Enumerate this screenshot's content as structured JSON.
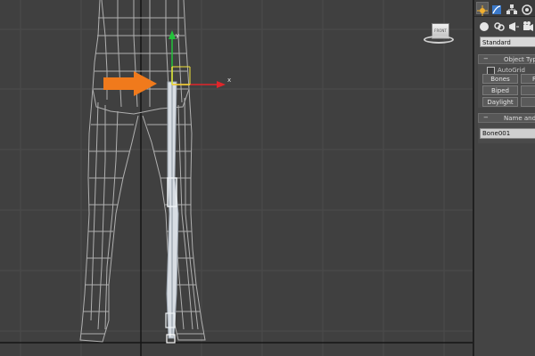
{
  "viewport": {
    "viewcube_label": "FRONT",
    "gizmo": {
      "x_label": "x",
      "y_label": "y"
    },
    "arrow_color": "#f07a1c"
  },
  "panel": {
    "tab_icons": [
      "create-icon",
      "modify-icon",
      "hierarchy-icon",
      "motion-icon"
    ],
    "category_icons": [
      "geometry-icon",
      "shapes-icon",
      "lights-icon",
      "cameras-icon"
    ],
    "dropdown_value": "Standard",
    "object_type": {
      "title": "Object Typ",
      "autogrid_label": "AutoGrid",
      "buttons": [
        "Bones",
        "Ri",
        "Biped",
        "",
        "Daylight",
        ""
      ]
    },
    "name_and_color": {
      "title": "Name and C",
      "name_value": "Bone001"
    }
  }
}
